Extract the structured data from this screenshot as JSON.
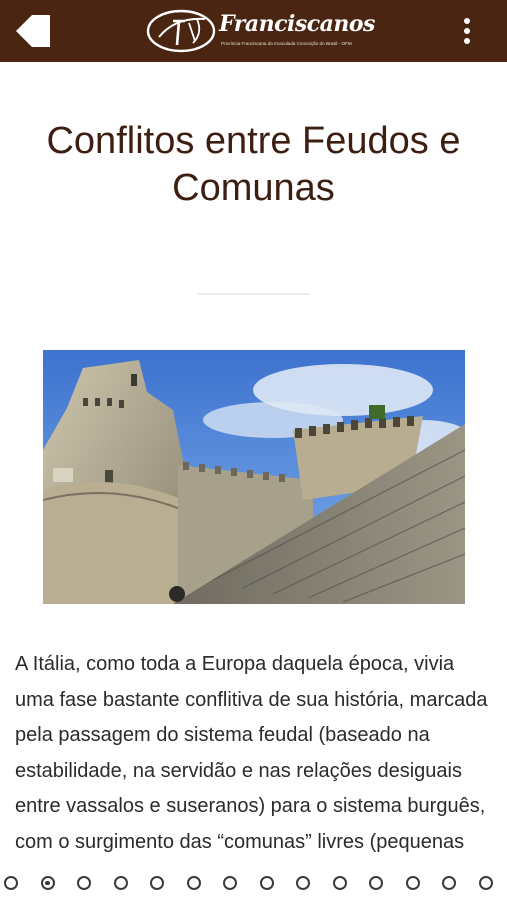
{
  "header": {
    "back_icon": "back-arrow-icon",
    "menu_icon": "more-vertical-icon",
    "logo_name": "Franciscanos",
    "logo_subtitle": "Província Franciscana da Imaculada Conceição do Brasil - OFM",
    "background_color": "#4a2612"
  },
  "article": {
    "title": "Conflitos entre Feudos e Comunas",
    "image_description": "castle-towers-photo",
    "body": "A Itália, como toda a Europa daquela época, vivia uma fase bastante conflitiva de sua história, marcada pela passagem do sistema feudal (baseado na estabilidade, na servidão e nas relações desiguais entre vassalos e suseranos) para o sistema burguês, com o surgimento das “comunas” livres (pequenas"
  },
  "pager": {
    "total_pages": 14,
    "current_page": 2
  }
}
